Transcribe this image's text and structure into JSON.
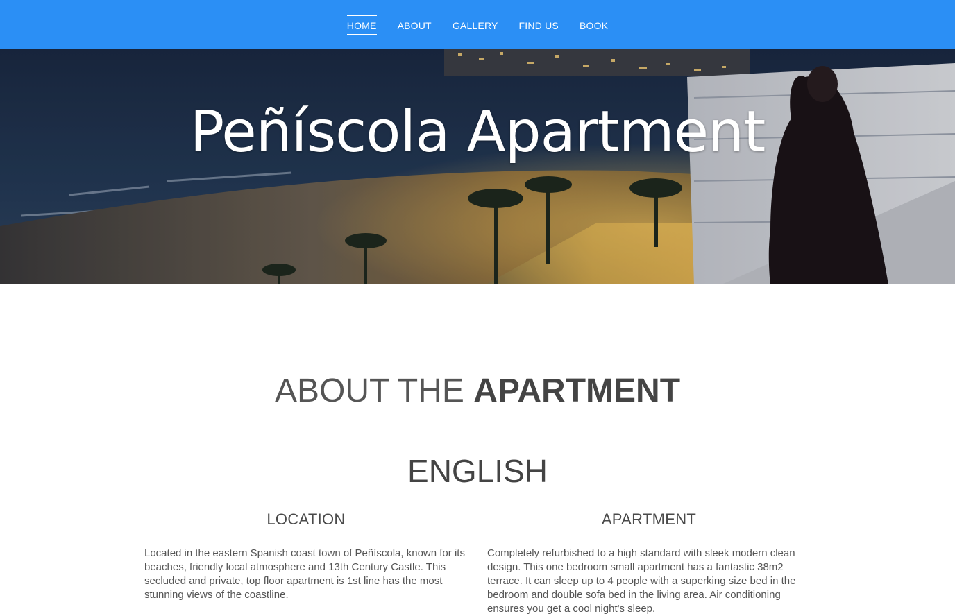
{
  "nav": {
    "items": [
      {
        "label": "HOME",
        "active": true
      },
      {
        "label": "ABOUT",
        "active": false
      },
      {
        "label": "GALLERY",
        "active": false
      },
      {
        "label": "FIND US",
        "active": false
      },
      {
        "label": "BOOK",
        "active": false
      }
    ]
  },
  "hero": {
    "title": "Peñíscola Apartment"
  },
  "about": {
    "heading_light": "ABOUT THE ",
    "heading_bold": "APARTMENT",
    "language": "ENGLISH",
    "location": {
      "title": "LOCATION",
      "text": "Located in the eastern Spanish coast town of Peñíscola, known for its beaches, friendly local atmosphere and 13th Century Castle.  This secluded and private, top floor apartment is 1st line has the most stunning views of the coastline."
    },
    "apartment": {
      "title": "APARTMENT",
      "text": "Completely refurbished to a high standard with sleek modern clean design.  This one bedroom small apartment has a fantastic 38m2 terrace.  It can sleep up to 4 people with a superking size bed in the bedroom and double sofa bed in the living area.  Air conditioning ensures you get a cool night's sleep."
    }
  },
  "colors": {
    "nav_bg": "#2b8ff5",
    "nav_text": "#ffffff",
    "heading_text": "#444444",
    "body_text": "#555555"
  }
}
